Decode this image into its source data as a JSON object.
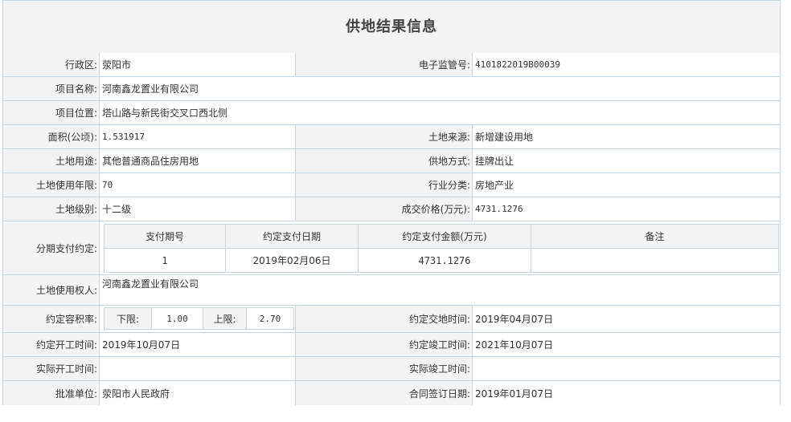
{
  "title": "供地结果信息",
  "rows": {
    "district": {
      "label": "行政区:",
      "value": "荥阳市"
    },
    "supervision_no": {
      "label": "电子监管号:",
      "value": "4101822019B00039"
    },
    "project_name": {
      "label": "项目名称:",
      "value": "河南鑫龙置业有限公司"
    },
    "project_location": {
      "label": "项目位置:",
      "value": "塔山路与新民街交叉口西北侧"
    },
    "area": {
      "label": "面积(公顷):",
      "value": "1.531917"
    },
    "land_source": {
      "label": "土地来源:",
      "value": "新增建设用地"
    },
    "land_use": {
      "label": "土地用途:",
      "value": "其他普通商品住房用地"
    },
    "supply_method": {
      "label": "供地方式:",
      "value": "挂牌出让"
    },
    "use_years": {
      "label": "土地使用年限:",
      "value": "70"
    },
    "industry": {
      "label": "行业分类:",
      "value": "房地产业"
    },
    "land_level": {
      "label": "土地级别:",
      "value": "十二级"
    },
    "deal_price": {
      "label": "成交价格(万元):",
      "value": "4731.1276"
    },
    "installment": {
      "label": "分期支付约定:",
      "headers": [
        "支付期号",
        "约定支付日期",
        "约定支付金额(万元)",
        "备注"
      ],
      "rows": [
        [
          "1",
          "2019年02月06日",
          "4731.1276",
          ""
        ]
      ]
    },
    "holder": {
      "label": "土地使用权人:",
      "value": "河南鑫龙置业有限公司"
    },
    "far": {
      "label": "约定容积率:",
      "lower_label": "下限:",
      "lower": "1.00",
      "upper_label": "上限:",
      "upper": "2.70"
    },
    "handover_time": {
      "label": "约定交地时间:",
      "value": "2019年04月07日"
    },
    "start_time": {
      "label": "约定开工时间:",
      "value": "2019年10月07日"
    },
    "complete_time": {
      "label": "约定竣工时间:",
      "value": "2021年10月07日"
    },
    "actual_start": {
      "label": "实际开工时间:",
      "value": ""
    },
    "actual_complete": {
      "label": "实际竣工时间:",
      "value": ""
    },
    "approver": {
      "label": "批准单位:",
      "value": "荥阳市人民政府"
    },
    "contract_date": {
      "label": "合同签订日期:",
      "value": "2019年01月07日"
    }
  }
}
